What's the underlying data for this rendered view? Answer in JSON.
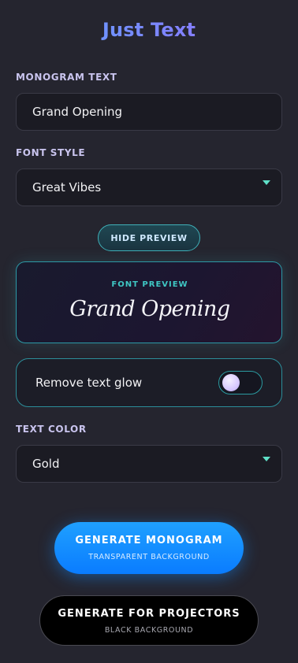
{
  "app": {
    "title": "Just Text"
  },
  "monogram": {
    "label": "MONOGRAM TEXT",
    "value": "Grand Opening"
  },
  "font_style": {
    "label": "FONT STYLE",
    "value": "Great Vibes"
  },
  "preview": {
    "toggle_label": "HIDE PREVIEW",
    "heading": "FONT PREVIEW",
    "text": "Grand Opening"
  },
  "glow_toggle": {
    "label": "Remove text glow",
    "on": false
  },
  "text_color": {
    "label": "TEXT COLOR",
    "value": "Gold"
  },
  "generate": {
    "label": "GENERATE MONOGRAM",
    "sub": "TRANSPARENT BACKGROUND"
  },
  "projectors": {
    "label": "GENERATE FOR PROJECTORS",
    "sub": "BLACK BACKGROUND"
  },
  "colors": {
    "background": "#25252f",
    "accent_teal": "#3fc7c4",
    "primary_blue": "#0a7cff",
    "title_gradient_start": "#5aa6ff",
    "title_gradient_end": "#9a6bff"
  },
  "icons": {
    "dropdown": "caret-down-icon",
    "toggle_knob": "switch-knob"
  }
}
